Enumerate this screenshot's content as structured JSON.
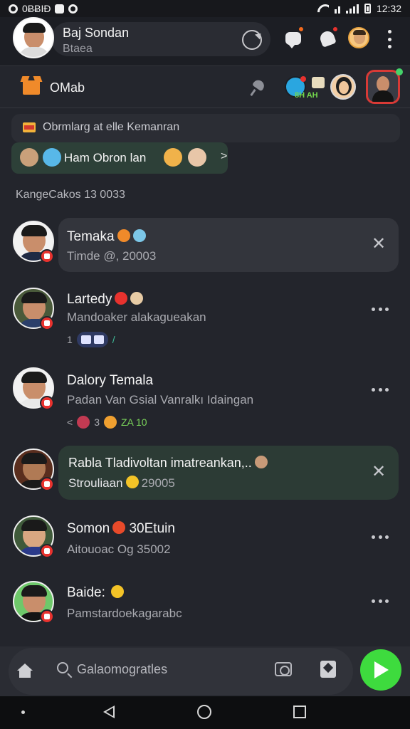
{
  "status_bar": {
    "left_text": "0ɃɃIÐ",
    "time": "12:32"
  },
  "header": {
    "user_name": "Baj Sondan",
    "user_sub": "Btaea"
  },
  "sub_header": {
    "title": "OMab",
    "story_label": "8H AH"
  },
  "banner": {
    "text": "Obrmlarg at elle Kemanran"
  },
  "pill_chip": {
    "text": "Ham Obron lan",
    "chevron": ">"
  },
  "section_title": "KangeCakos 13 0033",
  "chats": [
    {
      "name": "Temaka",
      "subtitle": "Timde @, 20003",
      "style": "bubble",
      "action": "close"
    },
    {
      "name": "Lartedy",
      "subtitle": "Mandoaker alakagueakan",
      "reactions_prefix": "1",
      "style": "plain",
      "action": "more"
    },
    {
      "name": "Dalory Temala",
      "subtitle": "Padan Van Gsial Vanralkı Idaingan",
      "reactions_prefix": "<",
      "reactions_count": "3",
      "reactions_green": "ZA 10",
      "style": "plain",
      "action": "more"
    },
    {
      "name": "Rabla Tladivoltan imatreankan,..",
      "subtitle": "Strouliaan",
      "subtitle_suffix": "29005",
      "style": "bubble-green",
      "action": "close"
    },
    {
      "name": "Somon",
      "name_suffix": "30Etuin",
      "subtitle": "Aitouoac Og 35002",
      "style": "plain",
      "action": "more"
    },
    {
      "name": "Baide:",
      "subtitle": "Pamstardoekagarabc",
      "style": "plain",
      "action": "more"
    }
  ],
  "bottom_bar": {
    "search_placeholder": "Galaomogratles"
  },
  "colors": {
    "accent": "#3edb3e",
    "badge_red": "#e8322e",
    "background": "#23252c"
  },
  "icons": {
    "close": "close-icon",
    "more": "more-icon",
    "send": "send-icon"
  }
}
